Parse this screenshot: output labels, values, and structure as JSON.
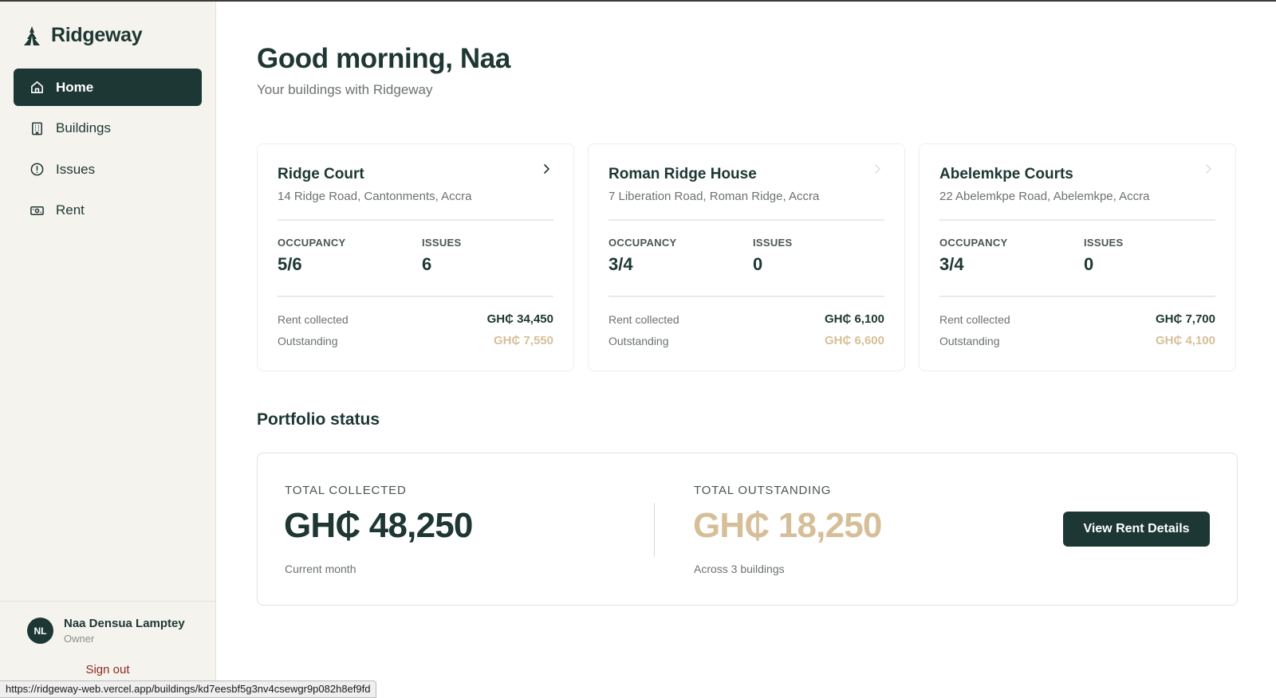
{
  "app": {
    "brand": "Ridgeway"
  },
  "sidebar": {
    "items": [
      {
        "label": "Home",
        "icon": "home-icon",
        "active": true
      },
      {
        "label": "Buildings",
        "icon": "building-icon",
        "active": false
      },
      {
        "label": "Issues",
        "icon": "alert-circle-icon",
        "active": false
      },
      {
        "label": "Rent",
        "icon": "banknote-icon",
        "active": false
      }
    ],
    "user": {
      "initials": "NL",
      "name": "Naa Densua Lamptey",
      "role": "Owner"
    },
    "sign_out": "Sign out"
  },
  "header": {
    "greeting": "Good morning, Naa",
    "subtitle": "Your buildings with Ridgeway"
  },
  "buildings": [
    {
      "name": "Ridge Court",
      "address": "14 Ridge Road, Cantonments, Accra",
      "occupancy_label": "OCCUPANCY",
      "occupancy": "5/6",
      "issues_label": "ISSUES",
      "issues": "6",
      "rent_collected_label": "Rent collected",
      "rent_collected": "GH₵ 34,450",
      "outstanding_label": "Outstanding",
      "outstanding": "GH₵ 7,550"
    },
    {
      "name": "Roman Ridge House",
      "address": "7 Liberation Road, Roman Ridge, Accra",
      "occupancy_label": "OCCUPANCY",
      "occupancy": "3/4",
      "issues_label": "ISSUES",
      "issues": "0",
      "rent_collected_label": "Rent collected",
      "rent_collected": "GH₵ 6,100",
      "outstanding_label": "Outstanding",
      "outstanding": "GH₵ 6,600"
    },
    {
      "name": "Abelemkpe Courts",
      "address": "22 Abelemkpe Road, Abelemkpe, Accra",
      "occupancy_label": "OCCUPANCY",
      "occupancy": "3/4",
      "issues_label": "ISSUES",
      "issues": "0",
      "rent_collected_label": "Rent collected",
      "rent_collected": "GH₵ 7,700",
      "outstanding_label": "Outstanding",
      "outstanding": "GH₵ 4,100"
    }
  ],
  "portfolio": {
    "title": "Portfolio status",
    "total_collected_label": "TOTAL COLLECTED",
    "total_collected": "GH₵ 48,250",
    "total_collected_note": "Current month",
    "total_outstanding_label": "TOTAL OUTSTANDING",
    "total_outstanding": "GH₵ 18,250",
    "total_outstanding_note": "Across 3 buildings",
    "button": "View Rent Details"
  },
  "status_bar": {
    "url": "https://ridgeway-web.vercel.app/buildings/kd7eesbf5g3nv4csewgr9p082h8ef9fd"
  },
  "colors": {
    "primary": "#1d3834",
    "accent_outstanding": "#d6bf98",
    "sidebar_bg": "#f5f3ee",
    "sign_out": "#8b2c1f"
  }
}
